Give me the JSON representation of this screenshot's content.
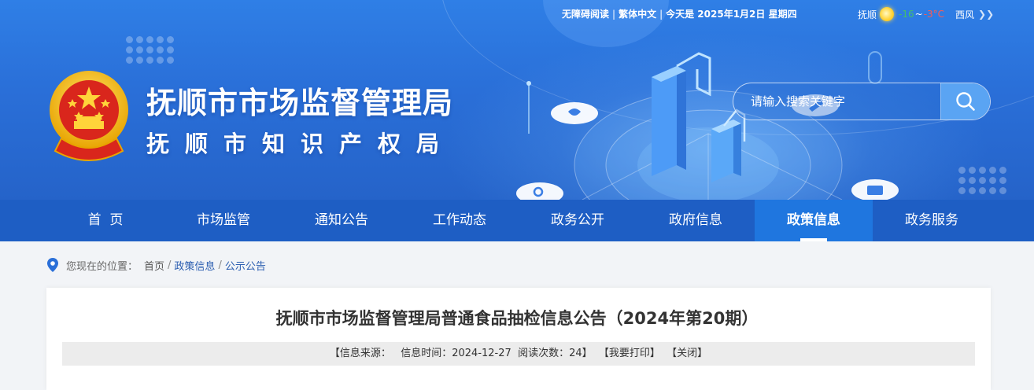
{
  "topbar": {
    "accessibility": "无障碍阅读",
    "traditional": "繁体中文",
    "today": "今天是 2025年1月2日 星期四"
  },
  "weather": {
    "city": "抚顺",
    "temp_low": "-16",
    "tilde": "~",
    "temp_high": "-3°C",
    "wind": "西风",
    "icon": "sun-icon"
  },
  "header": {
    "title_main": "抚顺市市场监督管理局",
    "title_sub": "抚顺市知识产权局"
  },
  "search": {
    "placeholder": "请输入搜索关键字"
  },
  "nav": {
    "items": [
      {
        "label": "首  页"
      },
      {
        "label": "市场监管"
      },
      {
        "label": "通知公告"
      },
      {
        "label": "工作动态"
      },
      {
        "label": "政务公开"
      },
      {
        "label": "政府信息"
      },
      {
        "label": "政策信息"
      },
      {
        "label": "政务服务"
      }
    ],
    "active_index": 6
  },
  "breadcrumb": {
    "prefix": "您现在的位置：",
    "items": [
      "首页",
      "政策信息",
      "公示公告"
    ],
    "sep": "/"
  },
  "article": {
    "title": "抚顺市市场监督管理局普通食品抽检信息公告（2024年第20期）",
    "source_label": "【信息来源：",
    "time_label": "信息时间：2024-12-27",
    "views_label": "阅读次数：24】",
    "print": "【我要打印】",
    "close": "【关闭】"
  },
  "colors": {
    "banner": "#2a6fd8",
    "nav": "#1e5ec4",
    "nav_active": "#1f76df",
    "breadcrumb_current": "#2a5db0"
  }
}
